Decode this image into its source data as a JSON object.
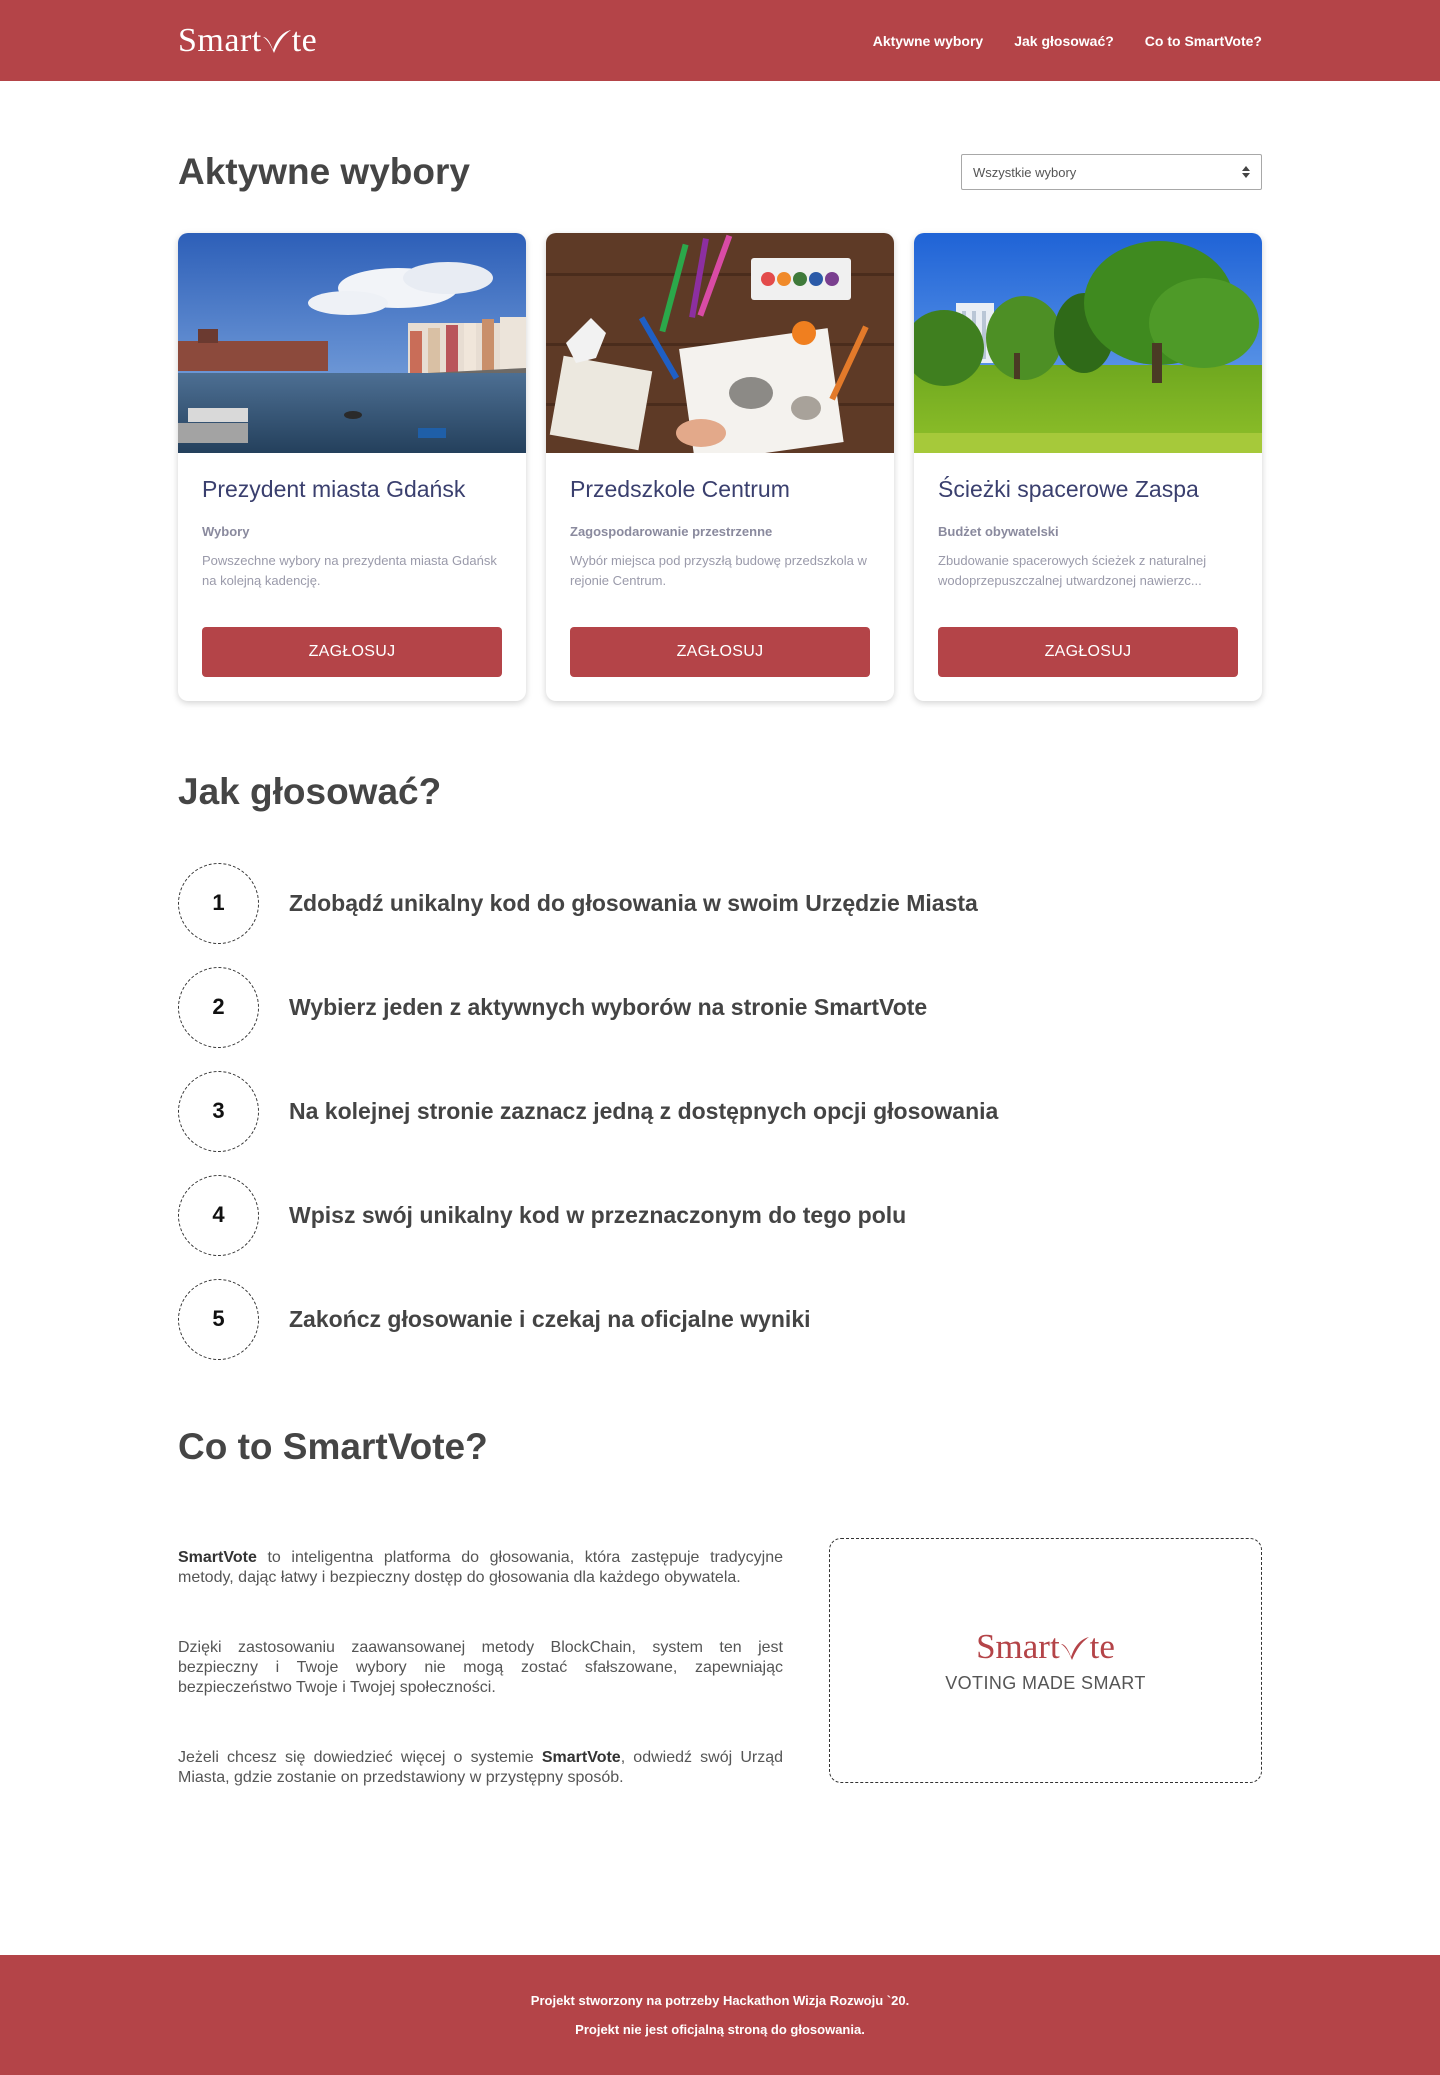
{
  "brand": {
    "name_before": "Smart",
    "name_after": "te",
    "accent": "#b44448"
  },
  "nav": [
    {
      "label": "Aktywne wybory"
    },
    {
      "label": "Jak głosować?"
    },
    {
      "label": "Co to SmartVote?"
    }
  ],
  "elections": {
    "title": "Aktywne wybory",
    "filter": {
      "value": "Wszystkie wybory"
    },
    "cards": [
      {
        "image": "gdansk-riverfront-photo",
        "title": "Prezydent miasta Gdańsk",
        "category": "Wybory",
        "description": "Powszechne wybory na prezydenta miasta Gdańsk na kolejną kadencję.",
        "button": "ZAGŁOSUJ"
      },
      {
        "image": "crayons-and-paints-photo",
        "title": "Przedszkole Centrum",
        "category": "Zagospodarowanie przestrzenne",
        "description": "Wybór miejsca pod przyszłą budowę przedszkola w rejonie Centrum.",
        "button": "ZAGŁOSUJ"
      },
      {
        "image": "park-tree-photo",
        "title": "Ścieżki spacerowe Zaspa",
        "category": "Budżet obywatelski",
        "description": "Zbudowanie spacerowych ścieżek z naturalnej wodoprzepuszczalnej utwardzonej nawierzc...",
        "button": "ZAGŁOSUJ"
      }
    ]
  },
  "howto": {
    "title": "Jak głosować?",
    "steps": [
      {
        "num": "1",
        "text": "Zdobądź unikalny kod do głosowania w swoim Urzędzie Miasta"
      },
      {
        "num": "2",
        "text": "Wybierz jeden z aktywnych wyborów na stronie SmartVote"
      },
      {
        "num": "3",
        "text": "Na kolejnej stronie zaznacz jedną z dostępnych opcji głosowania"
      },
      {
        "num": "4",
        "text": "Wpisz swój unikalny kod w przeznaczonym do tego polu"
      },
      {
        "num": "5",
        "text": "Zakończ głosowanie i czekaj na oficjalne wyniki"
      }
    ]
  },
  "about": {
    "title": "Co to SmartVote?",
    "p1_bold": "SmartVote",
    "p1_rest": " to inteligentna platforma do głosowania, która zastępuje tradycyjne metody, dając łatwy i bezpieczny dostęp do głosowania dla każdego obywatela.",
    "p2": "Dzięki zastosowaniu zaawansowanej metody BlockChain, system ten jest bezpieczny i Twoje wybory nie mogą zostać sfałszowane, zapewniając bezpieczeństwo Twoje i Twojej społeczności.",
    "p3_start": "Jeżeli chcesz się dowiedzieć więcej o systemie ",
    "p3_bold": "SmartVote",
    "p3_end": ", odwiedź swój Urząd Miasta, gdzie zostanie on przedstawiony w przystępny sposób.",
    "tagline": "VOTING MADE SMART"
  },
  "footer": {
    "line1": "Projekt stworzony na potrzeby Hackathon Wizja Rozwoju `20.",
    "line2": "Projekt nie jest oficjalną stroną do głosowania."
  }
}
